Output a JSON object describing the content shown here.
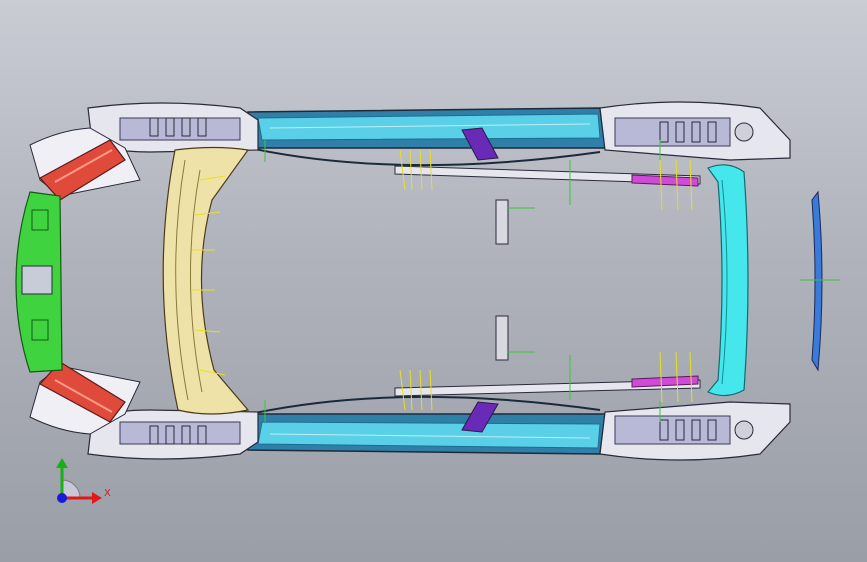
{
  "viewport": {
    "triad": {
      "x_label": "X",
      "colors": {
        "x": "#e01818",
        "y": "#18b018",
        "z": "#1818e0"
      }
    }
  },
  "colors": {
    "rail": "#5ad0e8",
    "rail_dark": "#1a8fb8",
    "front_bumper": "#3fd43f",
    "crash_can": "#e04a3a",
    "dash_panel": "#efe2a8",
    "rear_bumper": "#45e6ec",
    "purple_bracket": "#6a2ab8",
    "magenta_bar": "#d04ad8",
    "frame": "#e6e6ee",
    "lines": "#e8e020",
    "ticks": "#38c838"
  }
}
